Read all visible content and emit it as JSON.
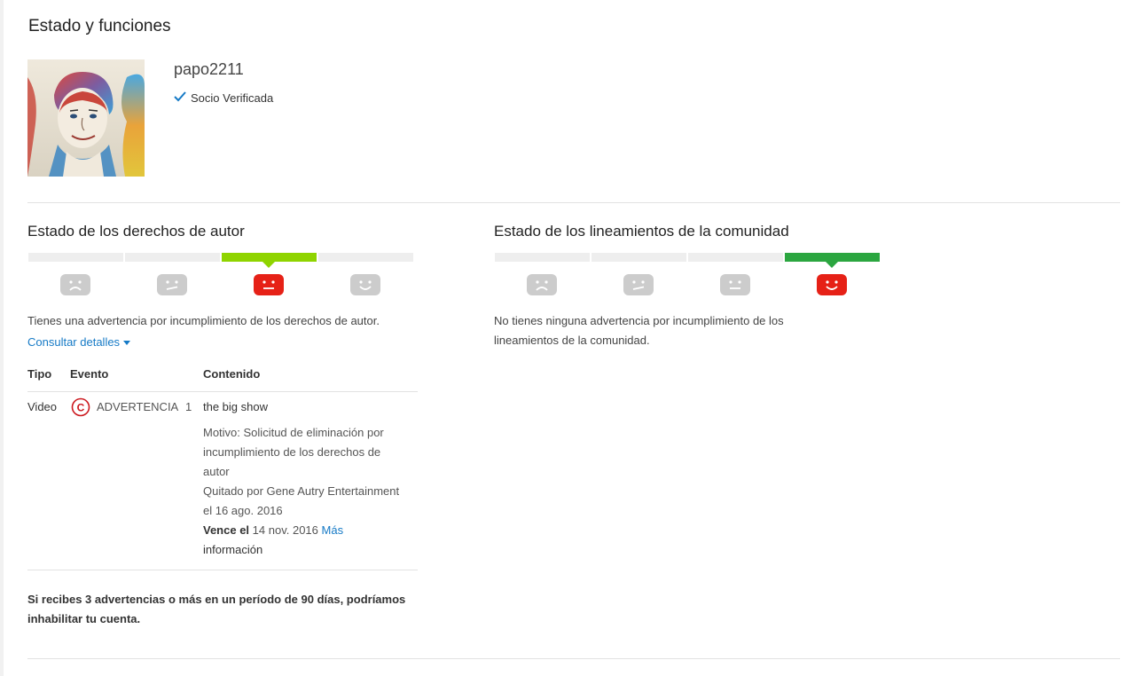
{
  "page": {
    "title": "Estado y funciones"
  },
  "profile": {
    "username": "papo2211",
    "verified_label": "Socio Verificada"
  },
  "copyright": {
    "title": "Estado de los derechos de autor",
    "meter_active_index": 2,
    "meter_faces": [
      "sad-face-icon",
      "meh-face-icon",
      "neutral-face-icon",
      "happy-face-icon"
    ],
    "description": "Tienes una advertencia por incumplimiento de los derechos de autor.",
    "details_link": "Consultar detalles",
    "table": {
      "headers": {
        "type": "Tipo",
        "event": "Evento",
        "content": "Contenido"
      },
      "row": {
        "type": "Video",
        "event": "ADVERTENCIA",
        "event_count": "1",
        "content_link": "the big show",
        "reason_line1": "Motivo: Solicitud de eliminación por",
        "reason_line2": "incumplimiento de los derechos de",
        "reason_line3": "autor",
        "removed_line1": "Quitado por Gene Autry Entertainment",
        "removed_line2": "el 16 ago. 2016",
        "expires_label": "Vence el",
        "expires_date": "14 nov. 2016",
        "more_info_1": "Más",
        "more_info_2": "información"
      }
    },
    "footnote_line1": "Si recibes 3 advertencias o más en un período de 90 días, podríamos",
    "footnote_line2": "inhabilitar tu cuenta."
  },
  "community": {
    "title": "Estado de los lineamientos de la comunidad",
    "meter_active_index": 3,
    "meter_faces": [
      "sad-face-icon",
      "meh-face-icon",
      "neutral-face-icon",
      "happy-face-icon"
    ],
    "description_line1": "No tienes ninguna advertencia por incumplimiento de los",
    "description_line2": "lineamientos de la comunidad."
  },
  "colors": {
    "link": "#167ac6",
    "meter_copyright_active": "#8fd400",
    "meter_community_active": "#2ba640",
    "face_active": "#e62117",
    "face_inactive": "#cccccc"
  }
}
